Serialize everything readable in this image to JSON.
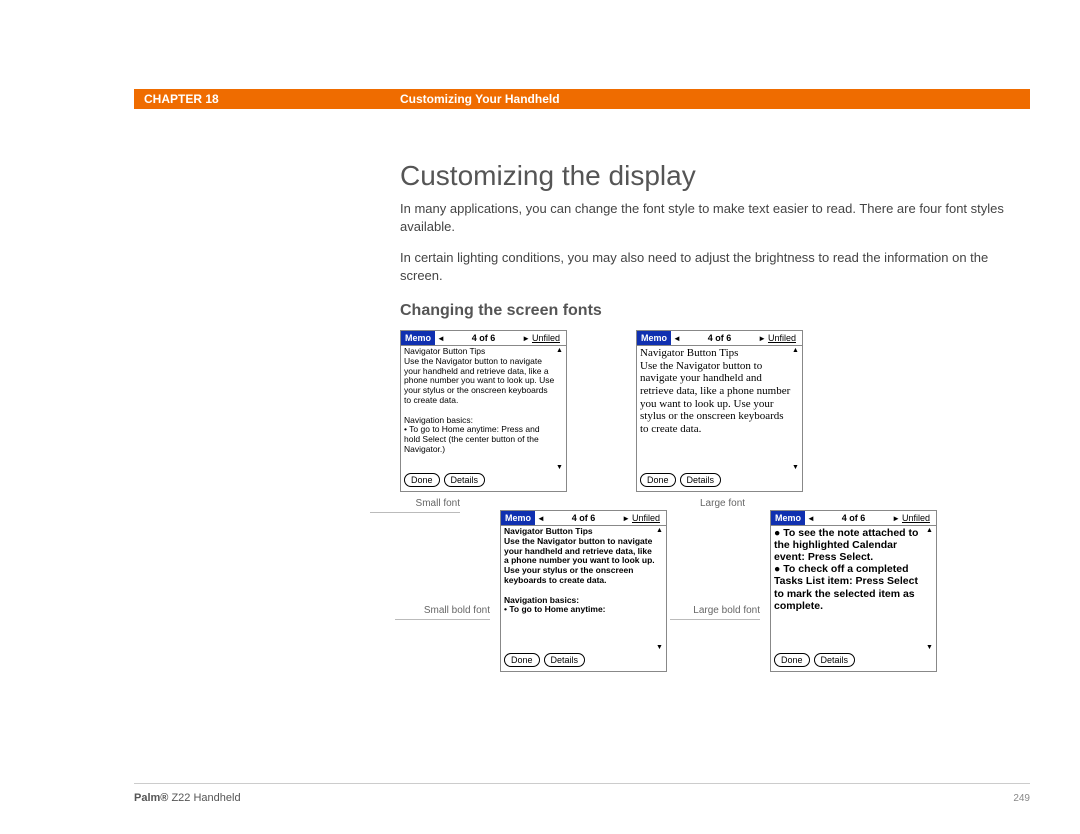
{
  "header": {
    "chapter": "CHAPTER 18",
    "title": "Customizing Your Handheld"
  },
  "section": {
    "title": "Customizing the display",
    "para1": "In many applications, you can change the font style to make text easier to read. There are four font styles available.",
    "para2": "In certain lighting conditions, you may also need to adjust the brightness to read the information on the screen.",
    "subsection_title": "Changing the screen fonts"
  },
  "memo_titlebar": {
    "app": "Memo",
    "counter": "4 of 6",
    "category": "Unfiled",
    "left_arrow": "◄",
    "right_arrow": "►",
    "scroll_up": "▲",
    "scroll_down": "▼"
  },
  "memo_buttons": {
    "done": "Done",
    "details": "Details"
  },
  "figures": {
    "small": {
      "text": "Navigator Button Tips\nUse the Navigator button to navigate your handheld and retrieve data, like a phone number you want to look up. Use your stylus or the onscreen keyboards to create data.\n\nNavigation basics:\n• To go to Home anytime: Press and hold Select (the center button of the Navigator.)",
      "caption": "Small font"
    },
    "small_bold": {
      "text": "Navigator Button Tips\nUse the Navigator button to navigate your handheld and retrieve data, like a phone number you want to look up. Use your stylus or the onscreen keyboards to create data.\n\nNavigation basics:\n• To go to Home anytime:",
      "caption": "Small bold font"
    },
    "large": {
      "text": "Navigator Button Tips\nUse the Navigator button to navigate your handheld and retrieve data, like a phone number you want to look up. Use your stylus or the onscreen keyboards to create data.",
      "caption": "Large font"
    },
    "large_bold": {
      "text": "● To see the note attached to the highlighted Calendar event: Press Select.\n● To check off a completed Tasks List item: Press Select to mark the selected item as complete.",
      "caption": "Large bold font"
    }
  },
  "footer": {
    "product_bold": "Palm®",
    "product_rest": " Z22 Handheld",
    "page": "249"
  }
}
